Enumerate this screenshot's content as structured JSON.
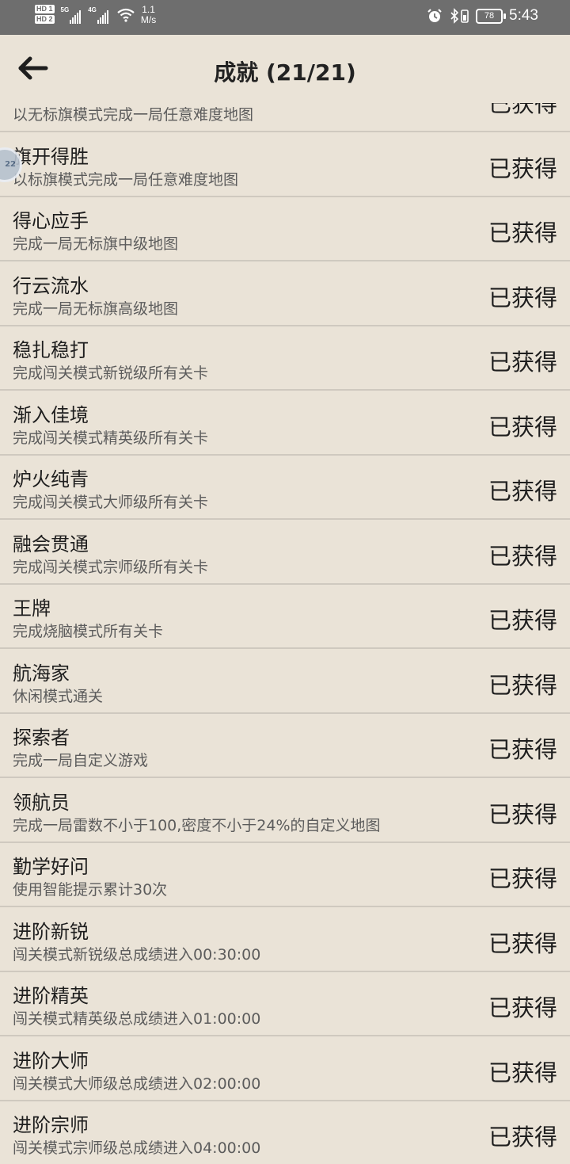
{
  "statusbar": {
    "hd1": "HD 1",
    "hd2": "HD 2",
    "net1": "5G",
    "net2": "4G",
    "speed_value": "1.1",
    "speed_unit": "M/s",
    "battery": "78",
    "time": "5:43"
  },
  "header": {
    "title": "成就 (21/21)"
  },
  "floating_ball": {
    "label": "22"
  },
  "achievements": [
    {
      "name": "",
      "desc": "以无标旗模式完成一局任意难度地图",
      "status": "已获得"
    },
    {
      "name": "旗开得胜",
      "desc": "以标旗模式完成一局任意难度地图",
      "status": "已获得"
    },
    {
      "name": "得心应手",
      "desc": "完成一局无标旗中级地图",
      "status": "已获得"
    },
    {
      "name": "行云流水",
      "desc": "完成一局无标旗高级地图",
      "status": "已获得"
    },
    {
      "name": "稳扎稳打",
      "desc": "完成闯关模式新锐级所有关卡",
      "status": "已获得"
    },
    {
      "name": "渐入佳境",
      "desc": "完成闯关模式精英级所有关卡",
      "status": "已获得"
    },
    {
      "name": "炉火纯青",
      "desc": "完成闯关模式大师级所有关卡",
      "status": "已获得"
    },
    {
      "name": "融会贯通",
      "desc": "完成闯关模式宗师级所有关卡",
      "status": "已获得"
    },
    {
      "name": "王牌",
      "desc": "完成烧脑模式所有关卡",
      "status": "已获得"
    },
    {
      "name": "航海家",
      "desc": "休闲模式通关",
      "status": "已获得"
    },
    {
      "name": "探索者",
      "desc": "完成一局自定义游戏",
      "status": "已获得"
    },
    {
      "name": "领航员",
      "desc": "完成一局雷数不小于100,密度不小于24%的自定义地图",
      "status": "已获得"
    },
    {
      "name": "勤学好问",
      "desc": "使用智能提示累计30次",
      "status": "已获得"
    },
    {
      "name": "进阶新锐",
      "desc": "闯关模式新锐级总成绩进入00:30:00",
      "status": "已获得"
    },
    {
      "name": "进阶精英",
      "desc": "闯关模式精英级总成绩进入01:00:00",
      "status": "已获得"
    },
    {
      "name": "进阶大师",
      "desc": "闯关模式大师级总成绩进入02:00:00",
      "status": "已获得"
    },
    {
      "name": "进阶宗师",
      "desc": "闯关模式宗师级总成绩进入04:00:00",
      "status": "已获得"
    }
  ]
}
